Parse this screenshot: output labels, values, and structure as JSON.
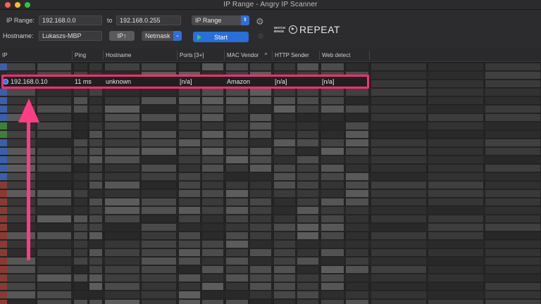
{
  "window": {
    "title": "IP Range - Angry IP Scanner"
  },
  "toolbar": {
    "ip_range_label": "IP Range:",
    "range_start": "192.168.0.0",
    "to_label": "to",
    "range_end": "192.168.0.255",
    "feeder_select": "IP Range",
    "hostname_label": "Hostname:",
    "hostname_value": "Lukaszs-MBP",
    "ip_button": "IP↑",
    "netmask_select": "Netmask",
    "start_button": "Start"
  },
  "watermark": {
    "small_line1": "WATCH",
    "small_line2": "BINGE",
    "big": "REPEAT"
  },
  "table": {
    "columns": [
      "IP",
      "Ping",
      "Hostname",
      "Ports [3+]",
      "MAC Vendor",
      "HTTP Sender",
      "Web detect"
    ],
    "sort_indicator": "^",
    "highlighted_row": {
      "ip": "192.168.0.10",
      "ping": "11 ms",
      "hostname": "unknown",
      "ports": "[n/a]",
      "mac_vendor": "Amazon",
      "http_sender": "[n/a]",
      "web_detect": "[n/a]"
    }
  },
  "colors": {
    "highlight": "#ff2d7a",
    "accent": "#2870d8",
    "status_blue": "#3b6fe0"
  }
}
